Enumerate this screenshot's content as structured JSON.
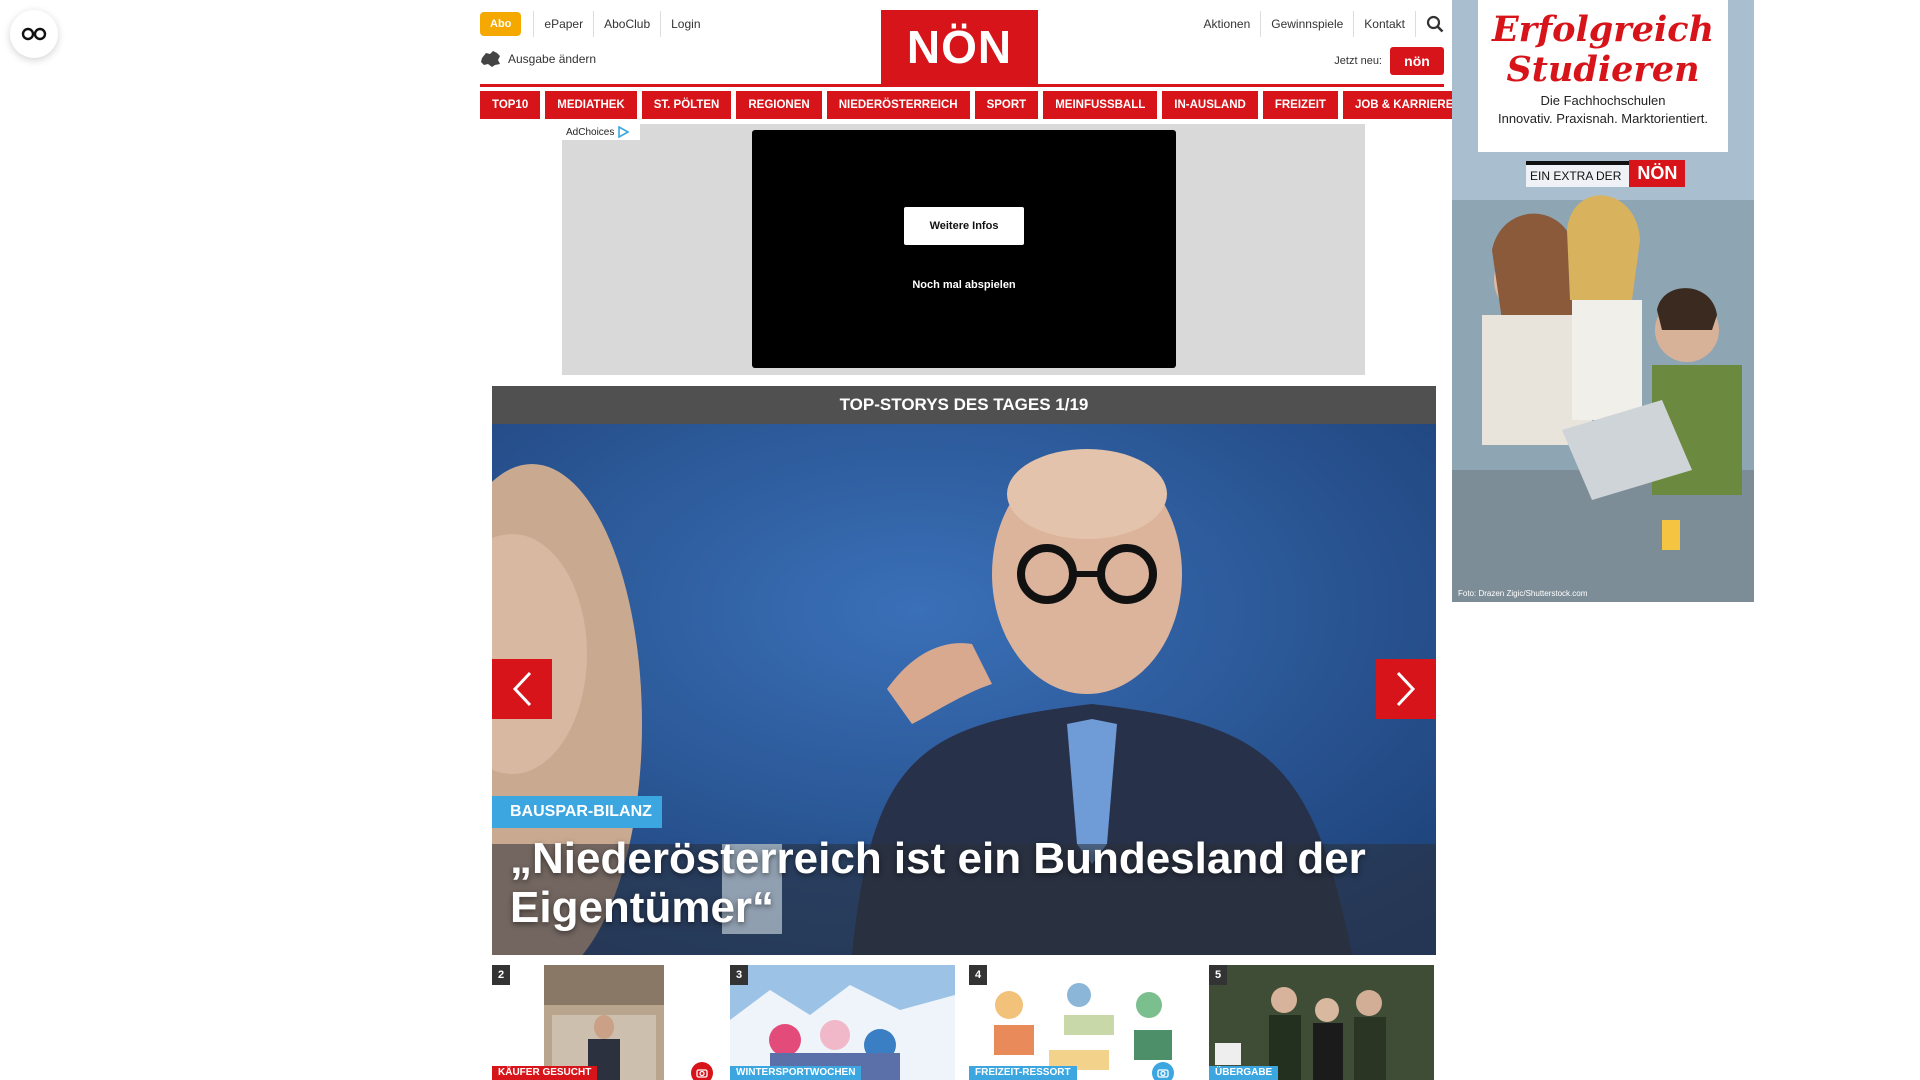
{
  "colors": {
    "brand_red": "#d7141a",
    "abo_orange": "#f5a800",
    "kicker_blue": "#3ba6e0",
    "dark_bar": "#505050"
  },
  "reader": {
    "icon": "glasses-icon"
  },
  "header": {
    "abo_label": "Abo",
    "top_links": [
      "ePaper",
      "AboClub",
      "Login"
    ],
    "ausgabe_label": "Ausgabe ändern",
    "logo_text": "NÖN",
    "right_links": [
      "Aktionen",
      "Gewinnspiele",
      "Kontakt"
    ],
    "jetzt_label": "Jetzt neu:",
    "jetzt_badge": "nön"
  },
  "nav": {
    "items": [
      "TOP10",
      "MEDIATHEK",
      "ST. PÖLTEN",
      "REGIONEN",
      "NIEDERÖSTERREICH",
      "SPORT",
      "MEINFUSSBALL",
      "IN-AUSLAND",
      "FREIZEIT",
      "JOB & KARRIERE"
    ]
  },
  "ad": {
    "adchoices": "AdChoices",
    "button_label": "Weitere Infos",
    "replay_label": "Noch mal abspielen"
  },
  "topstories": {
    "header": "TOP-STORYS DES TAGES 1/19",
    "kicker": "BAUSPAR-BILANZ",
    "title": "„Niederösterreich ist ein Bundesland der Eigentümer“"
  },
  "thumbs": [
    {
      "num": "2",
      "label": "KÄUFER GESUCHT",
      "label_color": "#d7141a"
    },
    {
      "num": "3",
      "label": "WINTERSPORTWOCHEN",
      "label_color": "#3ba6e0"
    },
    {
      "num": "4",
      "label": "FREIZEIT-RESSORT",
      "label_color": "#3ba6e0"
    },
    {
      "num": "5",
      "label": "ÜBERGABE",
      "label_color": "#3ba6e0"
    }
  ],
  "side_ad": {
    "title_line1": "Erfolgreich",
    "title_line2": "Studieren",
    "sub_line1": "Die Fachhochschulen",
    "sub_line2": "Innovativ. Praxisnah. Marktorientiert.",
    "extra_text": "EIN EXTRA DER",
    "extra_logo": "NÖN",
    "photo_credit": "Foto: Drazen Zigic/Shutterstock.com"
  }
}
